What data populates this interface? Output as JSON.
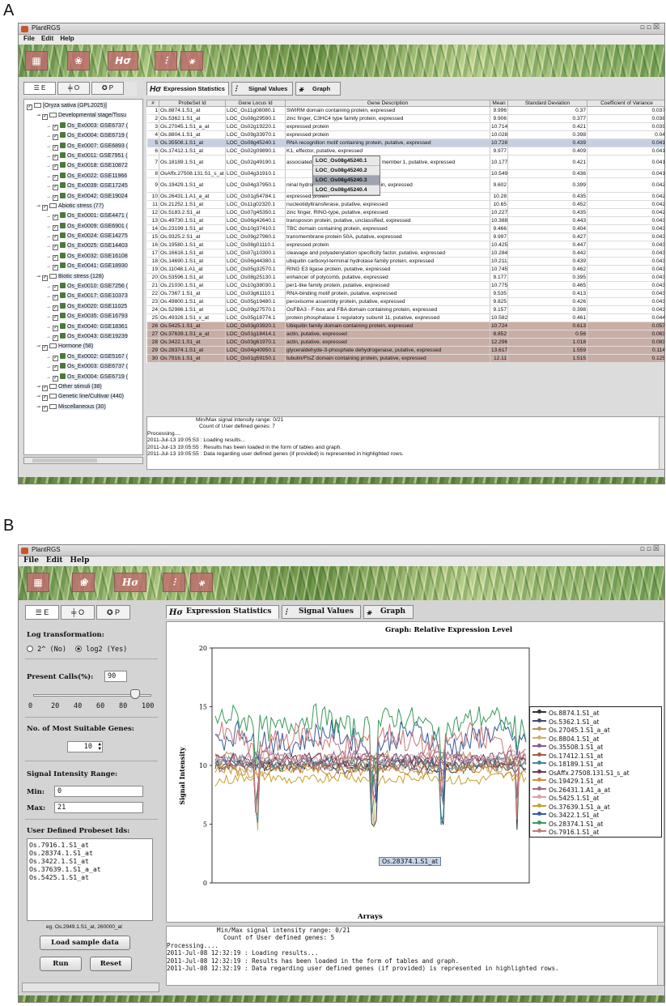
{
  "panel_a": {
    "letter": "A",
    "window_title": "PlantRGS",
    "menu": [
      "File",
      "Edit",
      "Help"
    ],
    "left_tabs": [
      "E",
      "O",
      "P"
    ],
    "tree": [
      {
        "label": "[Oryza sativa (GPL2025)]",
        "level": 0
      },
      {
        "label": "Developmental stage/Tissu",
        "level": 1
      },
      {
        "label": "Os_Ex0003: GSE6737 (",
        "level": 2
      },
      {
        "label": "Os_Ex0004: GSE6719 (",
        "level": 2
      },
      {
        "label": "Os_Ex0007: GSE6893 (",
        "level": 2
      },
      {
        "label": "Os_Ex0011: GSE7951 (",
        "level": 2
      },
      {
        "label": "Os_Ex0018: GSE10872",
        "level": 2
      },
      {
        "label": "Os_Ex0022: GSE11966",
        "level": 2
      },
      {
        "label": "Os_Ex0039: GSE17245",
        "level": 2
      },
      {
        "label": "Os_Ex0042: GSE19024",
        "level": 2
      },
      {
        "label": "Abiotic stress (77)",
        "level": 1
      },
      {
        "label": "Os_Ex0001: GSE4471 (",
        "level": 2
      },
      {
        "label": "Os_Ex0009: GSE6901 (",
        "level": 2
      },
      {
        "label": "Os_Ex0024: GSE14275",
        "level": 2
      },
      {
        "label": "Os_Ex0025: GSE14403",
        "level": 2
      },
      {
        "label": "Os_Ex0032: GSE16108",
        "level": 2
      },
      {
        "label": "Os_Ex0041: GSE18930",
        "level": 2
      },
      {
        "label": "Biotic stress (128)",
        "level": 1
      },
      {
        "label": "Os_Ex0010: GSE7256 (",
        "level": 2
      },
      {
        "label": "Os_Ex0017: GSE10373",
        "level": 2
      },
      {
        "label": "Os_Ex0020: GSE11025",
        "level": 2
      },
      {
        "label": "Os_Ex0035: GSE16793",
        "level": 2
      },
      {
        "label": "Os_Ex0040: GSE18361",
        "level": 2
      },
      {
        "label": "Os_Ex0043: GSE19239",
        "level": 2
      },
      {
        "label": "Hormone (58)",
        "level": 1
      },
      {
        "label": "Os_Ex0002: GSE5167 (",
        "level": 2
      },
      {
        "label": "Os_Ex0003: GSE6737 (",
        "level": 2
      },
      {
        "label": "Os_Ex0004: GSE6719 (",
        "level": 2
      },
      {
        "label": "Other stimuli (38)",
        "level": 1
      },
      {
        "label": "Genetic line/Cultivar (440)",
        "level": 1
      },
      {
        "label": "Miscellaneous (30)",
        "level": 1
      }
    ],
    "right_tabs": [
      "Expression Statistics",
      "Signal Values",
      "Graph"
    ],
    "columns": [
      "#",
      "ProbeSet Id",
      "Gene Locus Id",
      "Gene Description",
      "Mean",
      "Standard Deviation",
      "Coefficient of Variance"
    ],
    "rows": [
      [
        "1",
        "Os.8874.1.S1_at",
        "LOC_Os11g08080.1",
        "SWIRM domain containing protein, expressed",
        "9.996",
        "0.37",
        "0.037"
      ],
      [
        "2",
        "Os.5362.1.S1_at",
        "LOC_Os08g29590.1",
        "zinc finger, C3HC4 type family protein, expressed",
        "9.906",
        "0.377",
        "0.038"
      ],
      [
        "3",
        "Os.27045.1.S1_a_at",
        "LOC_Os02g19220.1",
        "expressed protein",
        "10.714",
        "0.421",
        "0.039"
      ],
      [
        "4",
        "Os.8804.1.S1_at",
        "LOC_Os09g33970.1",
        "expressed protein",
        "10.028",
        "0.398",
        "0.04"
      ],
      [
        "5",
        "Os.35508.1.S1_at",
        "LOC_Os08g45240.1",
        "RNA recognition motif containing protein, putative, expressed",
        "10.728",
        "0.439",
        "0.041"
      ],
      [
        "6",
        "Os.17412.1.S1_at",
        "LOC_Os02g09890.1",
        "K1, effector, putative, expressed",
        "9.977",
        "0.409",
        "0.041"
      ],
      [
        "7",
        "Os.18189.1.S1_at",
        "LOC_Os02g49190.1",
        "associated actin-dependent regulator of member 1, putative, expressed",
        "10.177",
        "0.421",
        "0.041"
      ],
      [
        "8",
        "OsAffx.27508.131.S1_s_at",
        "LOC_Os04g31910.1",
        "",
        "10.549",
        "0.436",
        "0.041"
      ],
      [
        "9",
        "Os.19429.1.S1_at",
        "LOC_Os04g37950.1",
        "ninal hydrolase domain containing protein, expressed",
        "9.602",
        "0.399",
        "0.042"
      ],
      [
        "10",
        "Os.26431.1.A1_a_at",
        "LOC_Os01g54784.1",
        "expressed protein",
        "10.28",
        "0.435",
        "0.042"
      ],
      [
        "11",
        "Os.21252.1.S1_at",
        "LOC_Os11g02320.1",
        "nucleotidyltransferase, putative, expressed",
        "10.65",
        "0.452",
        "0.042"
      ],
      [
        "12",
        "Os.5183.2.S1_at",
        "LOC_Os07g45350.1",
        "zinc finger, RING-type, putative, expressed",
        "10.227",
        "0.435",
        "0.042"
      ],
      [
        "13",
        "Os.49730.1.S1_at",
        "LOC_Os06g42640.1",
        "transposon protein, putative, unclassified, expressed",
        "10.388",
        "0.443",
        "0.043"
      ],
      [
        "14",
        "Os.23199.1.S1_at",
        "LOC_Os10g37410.1",
        "TBC domain containing protein, expressed",
        "9.466",
        "0.404",
        "0.043"
      ],
      [
        "15",
        "Os.9325.2.S1_at",
        "LOC_Os09g27960.1",
        "transmembrane protein 50A, putative, expressed",
        "9.997",
        "0.427",
        "0.043"
      ],
      [
        "16",
        "Os.19580.1.S1_at",
        "LOC_Os08g01110.1",
        "expressed protein",
        "10.425",
        "0.447",
        "0.043"
      ],
      [
        "17",
        "Os.16616.1.S1_at",
        "LOC_Os07g10300.1",
        "cleavage and polyadenylation specificity factor, putative, expressed",
        "10.284",
        "0.442",
        "0.043"
      ],
      [
        "18",
        "Os.14690.1.S1_at",
        "LOC_Os06g44380.1",
        "ubiquitin carboxyl-terminal hydrolase family protein, expressed",
        "10.211",
        "0.439",
        "0.043"
      ],
      [
        "19",
        "Os.11048.1.A1_at",
        "LOC_Os05g32570.1",
        "RING E3 ligase protein, putative, expressed",
        "10.745",
        "0.462",
        "0.043"
      ],
      [
        "20",
        "Os.53596.1.S1_at",
        "LOC_Os08g25130.1",
        "enhancer of polycomb, putative, expressed",
        "9.177",
        "0.395",
        "0.043"
      ],
      [
        "21",
        "Os.21030.1.S1_at",
        "LOC_Os10g38030.1",
        "per1-like family protein, putative, expressed",
        "10.775",
        "0.465",
        "0.043"
      ],
      [
        "22",
        "Os.7367.1.S1_at",
        "LOC_Os03g61110.1",
        "RNA-binding motif protein, putative, expressed",
        "9.535",
        "0.413",
        "0.043"
      ],
      [
        "23",
        "Os.49800.1.S1_at",
        "LOC_Os05g19480.1",
        "peroxisome assembly protein, putative, expressed",
        "9.825",
        "0.426",
        "0.043"
      ],
      [
        "24",
        "Os.52986.1.S1_at",
        "LOC_Os09g27570.1",
        "OsFBA3 - F-box and FBA domain containing protein, expressed",
        "9.157",
        "0.398",
        "0.043"
      ],
      [
        "25",
        "Os.49326.1.S1_x_at",
        "LOC_Os05g18774.1",
        "protein phosphatase 1 regulatory subunit 11, putative, expressed",
        "10.582",
        "0.461",
        "0.044"
      ],
      [
        "26",
        "Os.5425.1.S1_at",
        "LOC_Os03g03920.1",
        "Ubiquitin family domain containing protein, expressed",
        "10.724",
        "0.613",
        "0.057"
      ],
      [
        "27",
        "Os.37639.1.S1_a_at",
        "LOC_Os01g18414.1",
        "actin, putative, expressed",
        "8.852",
        "0.56",
        "0.063"
      ],
      [
        "28",
        "Os.3422.1.S1_at",
        "LOC_Os03g61970.1",
        "actin, putative, expressed",
        "12.296",
        "1.018",
        "0.083"
      ],
      [
        "29",
        "Os.28374.1.S1_at",
        "LOC_Os04g40950.1",
        "glyceraldehyde-3-phosphate dehydrogenase, putative, expressed",
        "13.617",
        "1.559",
        "0.114"
      ],
      [
        "30",
        "Os.7916.1.S1_at",
        "LOC_Os01g59150.1",
        "tubulin/FtsZ domain containing protein, putative, expressed",
        "12.11",
        "1.515",
        "0.125"
      ]
    ],
    "popup": [
      "LOC_Os08g45240.1",
      "LOC_Os08g45240.2",
      "LOC_Os08g45240.3",
      "LOC_Os08g45240.4"
    ],
    "summary_1": "Min/Max signal intensity range: 0/21",
    "summary_2": "Count of User defined genes: 7",
    "log": [
      "Processing....",
      "2011-Jul-13 19:05:53 : Loading results...",
      "2011-Jul-13 19:05:55 : Results has been loaded in the form of tables and graph.",
      "2011-Jul-13 19:05:55 : Data regarding user defined genes (if provided) is represented in highlighted rows."
    ]
  },
  "panel_b": {
    "letter": "B",
    "window_title": "PlantRGS",
    "menu": [
      "File",
      "Edit",
      "Help"
    ],
    "left_tabs": [
      "E",
      "O",
      "P"
    ],
    "log_transformation_label": "Log transformation:",
    "radio_no": "2^ (No)",
    "radio_yes": "log2 (Yes)",
    "log2_selected": true,
    "present_calls_label": "Present Calls(%):",
    "present_calls_value": "90",
    "slider_ticks": [
      "0",
      "20",
      "40",
      "60",
      "80",
      "100"
    ],
    "slider_value": 90,
    "num_genes_label": "No. of Most Suitable Genes:",
    "num_genes_value": "10",
    "signal_range_label": "Signal Intensity Range:",
    "min_label": "Min:",
    "min_value": "0",
    "max_label": "Max:",
    "max_value": "21",
    "user_probes_label": "User Defined Probeset Ids:",
    "user_probes": [
      "Os.7916.1.S1_at",
      "Os.28374.1.S1_at",
      "Os.3422.1.S1_at",
      "Os.37639.1.S1_a_at",
      "Os.5425.1.S1_at"
    ],
    "example_hint": "eg. Os.2949.1.S1_at, 260000_at",
    "load_sample_button": "Load sample data",
    "run_button": "Run",
    "reset_button": "Reset",
    "right_tabs": [
      "Expression Statistics",
      "Signal Values",
      "Graph"
    ],
    "tooltip": "Os.28374.1.S1_at",
    "summary_1": "Min/Max signal intensity range: 0/21",
    "summary_2": "Count of User defined genes: 5",
    "log": [
      "Processing....",
      "2011-Jul-08 12:32:19 : Loading results...",
      "2011-Jul-08 12:32:19 : Results has been loaded in the form of tables and graph.",
      "2011-Jul-08 12:32:19 : Data regarding user defined genes (if provided) is represented in highlighted rows."
    ]
  },
  "chart_data": {
    "type": "line",
    "title": "Graph: Relative Expression Level",
    "xlabel": "Arrays",
    "ylabel": "Signal Intensity",
    "ylim": [
      0,
      20
    ],
    "yticks": [
      0,
      5,
      10,
      15,
      20
    ],
    "grid": false,
    "legend_position": "right",
    "series": [
      {
        "name": "Os.8874.1.S1_at",
        "color": "#333333",
        "level": 10.0
      },
      {
        "name": "Os.5362.1.S1_at",
        "color": "#444a66",
        "level": 9.9
      },
      {
        "name": "Os.27045.1.S1_a_at",
        "color": "#b89060",
        "level": 10.7
      },
      {
        "name": "Os.8804.1.S1_at",
        "color": "#c8b070",
        "level": 10.0
      },
      {
        "name": "Os.35508.1.S1_at",
        "color": "#8a5a8a",
        "level": 10.7
      },
      {
        "name": "Os.17412.1.S1_at",
        "color": "#a06040",
        "level": 10.0
      },
      {
        "name": "Os.18189.1.S1_at",
        "color": "#3a8a9a",
        "level": 10.2
      },
      {
        "name": "OsAffx.27508.131.S1_s_at",
        "color": "#6a3a5a",
        "level": 10.5
      },
      {
        "name": "Os.19429.1.S1_at",
        "color": "#d09040",
        "level": 9.6
      },
      {
        "name": "Os.26431.1.A1_a_at",
        "color": "#9a6a8a",
        "level": 10.3
      },
      {
        "name": "Os.5425.1.S1_at",
        "color": "#d8a0a8",
        "level": 10.7
      },
      {
        "name": "Os.37639.1.S1_a_at",
        "color": "#c8a030",
        "level": 8.9
      },
      {
        "name": "Os.3422.1.S1_at",
        "color": "#3a5a9a",
        "level": 12.3
      },
      {
        "name": "Os.28374.1.S1_at",
        "color": "#3a9a5a",
        "level": 13.6
      },
      {
        "name": "Os.7916.1.S1_at",
        "color": "#c87878",
        "level": 12.1
      }
    ]
  }
}
